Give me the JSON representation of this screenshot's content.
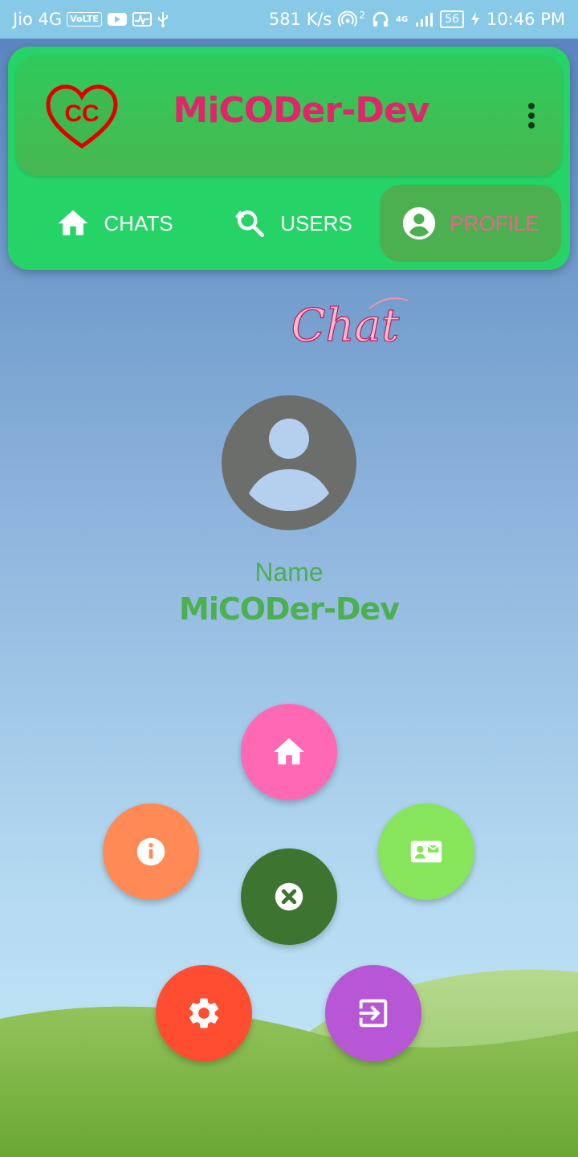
{
  "status_bar": {
    "carrier": "Jio 4G",
    "volte_badge": "VoLTE",
    "speed": "581 K/s",
    "hotspot_count": "2",
    "network_badge": "4G",
    "battery": "56",
    "time": "10:46 PM"
  },
  "header": {
    "logo_text": "CC",
    "title": "MiCODer-Dev",
    "menu_icon": "more-vert-icon",
    "colors": {
      "header_bg": "#26d366",
      "title": "#e0256b",
      "active_tab_bg": "#4caf50",
      "active_tab_text": "#f06292"
    }
  },
  "tabs": [
    {
      "label": "CHATS",
      "icon": "home-icon",
      "active": false
    },
    {
      "label": "USERS",
      "icon": "search-icon",
      "active": false
    },
    {
      "label": "PROFILE",
      "icon": "account-circle-icon",
      "active": true
    }
  ],
  "brand": {
    "chat_logo_text": "Chat"
  },
  "profile": {
    "avatar_icon": "account-circle-icon",
    "name_label": "Name",
    "name_value": "MiCODer-Dev",
    "text_color": "#4caf50"
  },
  "fab_menu": {
    "items": [
      {
        "name": "home",
        "icon": "home-icon",
        "color": "#ff69b4"
      },
      {
        "name": "info",
        "icon": "info-icon",
        "color": "#ff8a56"
      },
      {
        "name": "contact",
        "icon": "contact-mail-icon",
        "color": "#86e55a"
      },
      {
        "name": "close",
        "icon": "close-circle-icon",
        "color": "#3d7430"
      },
      {
        "name": "settings",
        "icon": "gear-icon",
        "color": "#ff4d32"
      },
      {
        "name": "logout",
        "icon": "exit-icon",
        "color": "#b757d6"
      }
    ]
  }
}
